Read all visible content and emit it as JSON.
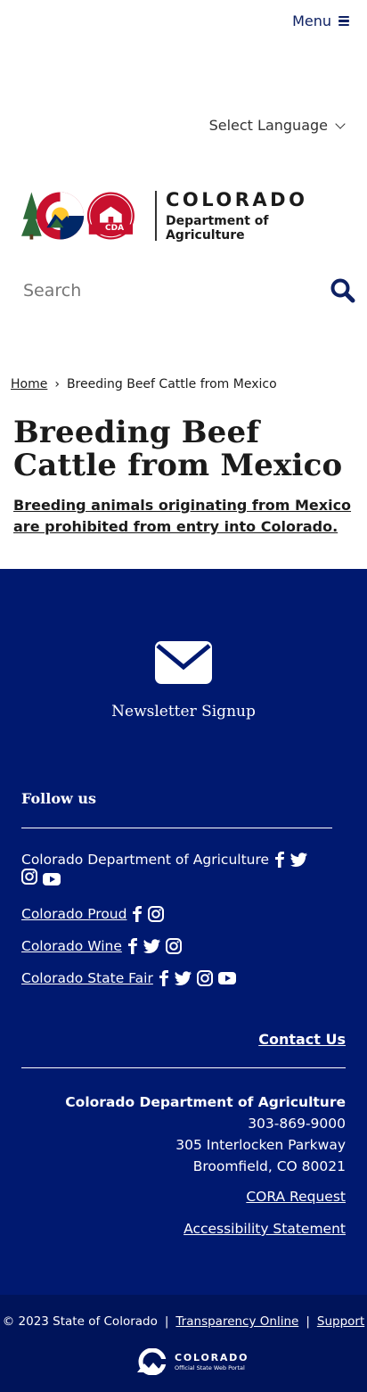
{
  "header": {
    "menu_label": "Menu",
    "language_label": "Select Language",
    "logo_title": "COLORADO",
    "logo_subtitle": "Department of Agriculture",
    "logo_badge": "CDA",
    "search_placeholder": "Search"
  },
  "breadcrumb": {
    "home": "Home",
    "separator": "›",
    "current": "Breeding Beef Cattle from Mexico"
  },
  "main": {
    "title": "Breeding Beef Cattle from Mexico",
    "intro": "Breeding animals originating from Mexico are prohibited from entry into Colorado."
  },
  "footer": {
    "newsletter_label": "Newsletter Signup",
    "follow_title": "Follow us",
    "social": [
      {
        "name": "Colorado Department of Agriculture",
        "icons": [
          "facebook-icon",
          "twitter-icon",
          "instagram-icon",
          "youtube-icon"
        ]
      },
      {
        "name": "Colorado Proud",
        "icons": [
          "facebook-icon",
          "instagram-icon"
        ]
      },
      {
        "name": "Colorado Wine",
        "icons": [
          "facebook-icon",
          "twitter-icon",
          "instagram-icon"
        ]
      },
      {
        "name": "Colorado State Fair",
        "icons": [
          "facebook-icon",
          "twitter-icon",
          "instagram-icon",
          "youtube-icon"
        ]
      }
    ],
    "contact_label": "Contact Us",
    "org_name": "Colorado Department of Agriculture",
    "phone": "303-869-9000",
    "address_line1": "305 Interlocken Parkway",
    "address_line2": "Broomfield, CO 80021",
    "cora_label": "CORA Request",
    "accessibility_label": "Accessibility Statement"
  },
  "bottom": {
    "copyright": "© 2023 State of Colorado",
    "sep": "|",
    "transparency_label": "Transparency Online",
    "support_label": "Support",
    "state_logo_title": "COLORADO",
    "state_logo_subtitle": "Official State Web Portal"
  },
  "colors": {
    "brand_navy": "#001970",
    "bottom_navy": "#00145a",
    "menu_navy": "#0e2163",
    "red": "#c8102e",
    "gold": "#ffc72c",
    "green": "#2e6b3a"
  }
}
